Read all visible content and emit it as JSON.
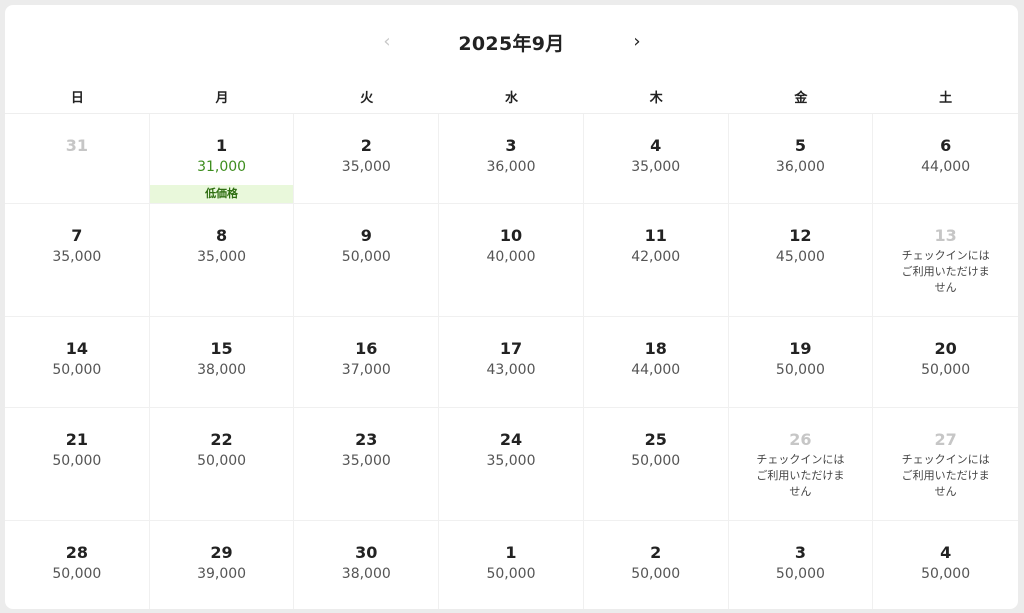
{
  "header": {
    "title": "2025年9月",
    "prev_icon": "‹",
    "next_icon": "›"
  },
  "weekdays": [
    "日",
    "月",
    "火",
    "水",
    "木",
    "金",
    "土"
  ],
  "unavailable_note": "チェックインにはご利用いただけません",
  "low_badge": "低価格",
  "colors": {
    "low_price": "#3e8e1f",
    "badge_bg": "#e9f8db",
    "muted": "#c6c6c6"
  },
  "weeks": [
    [
      {
        "day": "31",
        "price": "",
        "state": "outside"
      },
      {
        "day": "1",
        "price": "31,000",
        "state": "low",
        "badge": "低価格"
      },
      {
        "day": "2",
        "price": "35,000",
        "state": "normal"
      },
      {
        "day": "3",
        "price": "36,000",
        "state": "normal"
      },
      {
        "day": "4",
        "price": "35,000",
        "state": "normal"
      },
      {
        "day": "5",
        "price": "36,000",
        "state": "normal"
      },
      {
        "day": "6",
        "price": "44,000",
        "state": "normal"
      }
    ],
    [
      {
        "day": "7",
        "price": "35,000",
        "state": "normal"
      },
      {
        "day": "8",
        "price": "35,000",
        "state": "normal"
      },
      {
        "day": "9",
        "price": "50,000",
        "state": "normal"
      },
      {
        "day": "10",
        "price": "40,000",
        "state": "normal"
      },
      {
        "day": "11",
        "price": "42,000",
        "state": "normal"
      },
      {
        "day": "12",
        "price": "45,000",
        "state": "normal"
      },
      {
        "day": "13",
        "price": "",
        "state": "unavailable",
        "note": "チェックインにはご利用いただけません"
      }
    ],
    [
      {
        "day": "14",
        "price": "50,000",
        "state": "normal"
      },
      {
        "day": "15",
        "price": "38,000",
        "state": "normal"
      },
      {
        "day": "16",
        "price": "37,000",
        "state": "normal"
      },
      {
        "day": "17",
        "price": "43,000",
        "state": "normal"
      },
      {
        "day": "18",
        "price": "44,000",
        "state": "normal"
      },
      {
        "day": "19",
        "price": "50,000",
        "state": "normal"
      },
      {
        "day": "20",
        "price": "50,000",
        "state": "normal"
      }
    ],
    [
      {
        "day": "21",
        "price": "50,000",
        "state": "normal"
      },
      {
        "day": "22",
        "price": "50,000",
        "state": "normal"
      },
      {
        "day": "23",
        "price": "35,000",
        "state": "normal"
      },
      {
        "day": "24",
        "price": "35,000",
        "state": "normal"
      },
      {
        "day": "25",
        "price": "50,000",
        "state": "normal"
      },
      {
        "day": "26",
        "price": "",
        "state": "unavailable",
        "note": "チェックインにはご利用いただけません"
      },
      {
        "day": "27",
        "price": "",
        "state": "unavailable",
        "note": "チェックインにはご利用いただけません"
      }
    ],
    [
      {
        "day": "28",
        "price": "50,000",
        "state": "normal"
      },
      {
        "day": "29",
        "price": "39,000",
        "state": "normal"
      },
      {
        "day": "30",
        "price": "38,000",
        "state": "normal"
      },
      {
        "day": "1",
        "price": "50,000",
        "state": "normal"
      },
      {
        "day": "2",
        "price": "50,000",
        "state": "normal"
      },
      {
        "day": "3",
        "price": "50,000",
        "state": "normal"
      },
      {
        "day": "4",
        "price": "50,000",
        "state": "normal"
      }
    ]
  ]
}
